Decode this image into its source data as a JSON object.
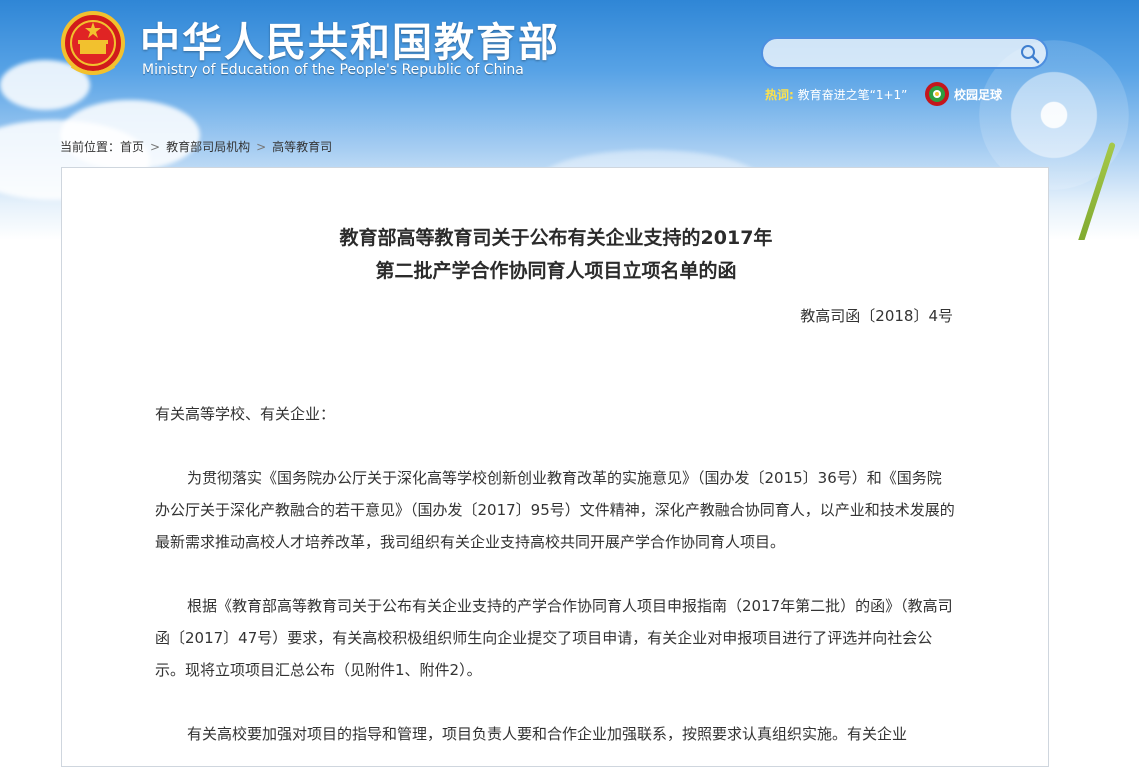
{
  "header": {
    "site_title": "中华人民共和国教育部",
    "site_subtitle": "Ministry of Education of the People's Republic of China",
    "emblem_icon": "national-emblem-icon",
    "search_icon": "search-icon",
    "search_value": "",
    "hot_label": "热词:",
    "hot_text": "教育奋进之笔“1+1”",
    "football_label": "校园足球",
    "colors": {
      "accent_blue": "#4d8fe0",
      "hot_yellow": "#ffe24a"
    }
  },
  "breadcrumb": {
    "prefix": "当前位置：",
    "items": [
      "首页",
      "教育部司局机构",
      "高等教育司"
    ],
    "separator": ">"
  },
  "document": {
    "title_line1": "教育部高等教育司关于公布有关企业支持的2017年",
    "title_line2": "第二批产学合作协同育人项目立项名单的函",
    "doc_number": "教高司函〔2018〕4号",
    "salutation": "有关高等学校、有关企业：",
    "paragraphs": [
      "为贯彻落实《国务院办公厅关于深化高等学校创新创业教育改革的实施意见》（国办发〔2015〕36号）和《国务院办公厅关于深化产教融合的若干意见》（国办发〔2017〕95号）文件精神，深化产教融合协同育人，以产业和技术发展的最新需求推动高校人才培养改革，我司组织有关企业支持高校共同开展产学合作协同育人项目。",
      "根据《教育部高等教育司关于公布有关企业支持的产学合作协同育人项目申报指南（2017年第二批）的函》（教高司函〔2017〕47号）要求，有关高校积极组织师生向企业提交了项目申请，有关企业对申报项目进行了评选并向社会公示。现将立项项目汇总公布（见附件1、附件2）。",
      "有关高校要加强对项目的指导和管理，项目负责人要和合作企业加强联系，按照要求认真组织实施。有关企业"
    ]
  }
}
